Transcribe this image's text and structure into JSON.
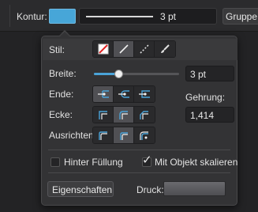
{
  "toolbar": {
    "stroke_label": "Kontur:",
    "stroke_color": "#47a6d8",
    "width_value": "3 pt",
    "group_button_label": "Gruppe a"
  },
  "panel": {
    "style": {
      "label": "Stil:",
      "options": [
        {
          "name": "none-style-icon",
          "selected": false
        },
        {
          "name": "solid-line-icon",
          "selected": true
        },
        {
          "name": "dashed-line-icon",
          "selected": false
        },
        {
          "name": "brush-icon",
          "selected": false
        }
      ]
    },
    "width": {
      "label": "Breite:",
      "value": "3 pt",
      "slider_fraction": 0.3
    },
    "caps": {
      "label": "Ende:"
    },
    "joins": {
      "label": "Ecke:"
    },
    "miter": {
      "label": "Gehrung:",
      "value": "1,414"
    },
    "align": {
      "label": "Ausrichten:"
    },
    "behind_fill": {
      "label": "Hinter Füllung",
      "checked": false
    },
    "scale_with_object": {
      "label": "Mit Objekt skalieren",
      "checked": true
    },
    "properties_button": "Eigenschaften...",
    "pressure_label": "Druck:"
  },
  "colors": {
    "accent": "#4aa3d8",
    "panel_bg": "#333335",
    "app_bg": "#232325"
  }
}
